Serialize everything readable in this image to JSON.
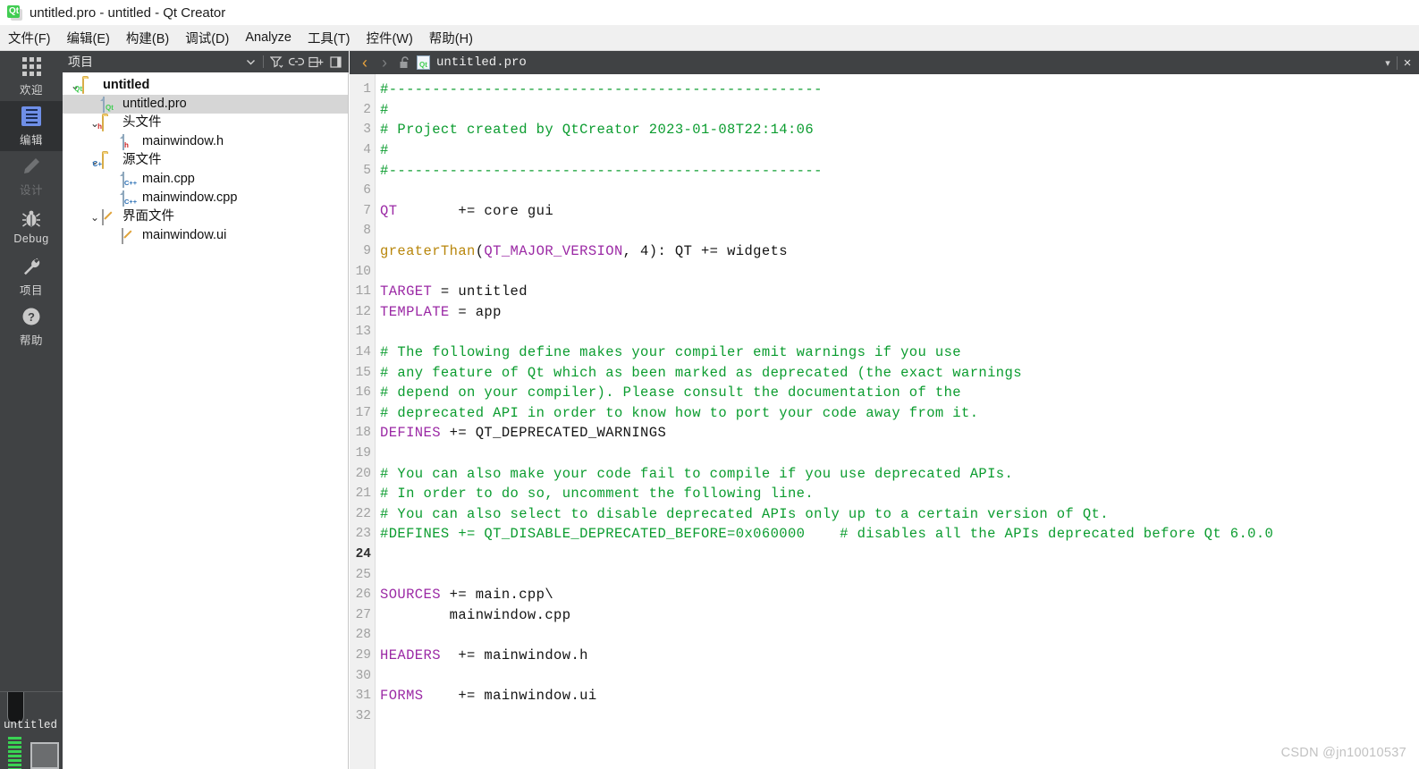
{
  "window": {
    "title": "untitled.pro - untitled - Qt Creator",
    "logo_text": "Qt"
  },
  "menubar": {
    "items": [
      {
        "label": "文件(F)",
        "name": "menu-file"
      },
      {
        "label": "编辑(E)",
        "name": "menu-edit"
      },
      {
        "label": "构建(B)",
        "name": "menu-build"
      },
      {
        "label": "调试(D)",
        "name": "menu-debug"
      },
      {
        "label": "Analyze",
        "name": "menu-analyze"
      },
      {
        "label": "工具(T)",
        "name": "menu-tools"
      },
      {
        "label": "控件(W)",
        "name": "menu-widgets"
      },
      {
        "label": "帮助(H)",
        "name": "menu-help"
      }
    ]
  },
  "modebar": {
    "items": [
      {
        "label": "欢迎",
        "icon": "grid-icon",
        "state": "normal"
      },
      {
        "label": "编辑",
        "icon": "document-icon",
        "state": "active"
      },
      {
        "label": "设计",
        "icon": "pencil-icon",
        "state": "disabled"
      },
      {
        "label": "Debug",
        "icon": "bug-icon",
        "state": "normal"
      },
      {
        "label": "项目",
        "icon": "wrench-icon",
        "state": "normal"
      },
      {
        "label": "帮助",
        "icon": "question-icon",
        "state": "normal"
      }
    ]
  },
  "kit_selector": {
    "name": "untitled"
  },
  "project_panel": {
    "title": "项目",
    "toolbar": [
      {
        "name": "chevron-down-icon"
      },
      {
        "name": "filter-icon"
      },
      {
        "name": "link-icon"
      },
      {
        "name": "split-pane-icon"
      },
      {
        "name": "close-panel-icon"
      }
    ],
    "tree": [
      {
        "label": "untitled",
        "indent": 0,
        "chev": "⌄",
        "icon": "folder-pro",
        "bold": true,
        "selected": false
      },
      {
        "label": "untitled.pro",
        "indent": 1,
        "chev": "",
        "icon": "file-pro",
        "bold": false,
        "selected": true
      },
      {
        "label": "头文件",
        "indent": 1,
        "chev": "⌄",
        "icon": "folder-h",
        "bold": false,
        "selected": false
      },
      {
        "label": "mainwindow.h",
        "indent": 2,
        "chev": "",
        "icon": "file-h",
        "bold": false,
        "selected": false
      },
      {
        "label": "源文件",
        "indent": 1,
        "chev": "⌄",
        "icon": "folder-cpp",
        "bold": false,
        "selected": false
      },
      {
        "label": "main.cpp",
        "indent": 2,
        "chev": "",
        "icon": "file-cpp",
        "bold": false,
        "selected": false
      },
      {
        "label": "mainwindow.cpp",
        "indent": 2,
        "chev": "",
        "icon": "file-cpp",
        "bold": false,
        "selected": false
      },
      {
        "label": "界面文件",
        "indent": 1,
        "chev": "⌄",
        "icon": "folder-ui",
        "bold": false,
        "selected": false
      },
      {
        "label": "mainwindow.ui",
        "indent": 2,
        "chev": "",
        "icon": "file-ui",
        "bold": false,
        "selected": false
      }
    ]
  },
  "editor": {
    "tab": {
      "back_arrow": "‹",
      "forward_arrow": "›",
      "lock_icon": "unlocked-icon",
      "filename": "untitled.pro",
      "dropdown": "▾",
      "close": "×"
    },
    "current_line": 24,
    "lines": [
      {
        "n": 1,
        "tokens": [
          {
            "t": "#--------------------------------------------------",
            "c": "comment"
          }
        ]
      },
      {
        "n": 2,
        "tokens": [
          {
            "t": "#",
            "c": "comment"
          }
        ]
      },
      {
        "n": 3,
        "tokens": [
          {
            "t": "# Project created by QtCreator 2023-01-08T22:14:06",
            "c": "comment"
          }
        ]
      },
      {
        "n": 4,
        "tokens": [
          {
            "t": "#",
            "c": "comment"
          }
        ]
      },
      {
        "n": 5,
        "tokens": [
          {
            "t": "#--------------------------------------------------",
            "c": "comment"
          }
        ]
      },
      {
        "n": 6,
        "tokens": []
      },
      {
        "n": 7,
        "tokens": [
          {
            "t": "QT",
            "c": "var"
          },
          {
            "t": "       += core gui",
            "c": "plain"
          }
        ]
      },
      {
        "n": 8,
        "tokens": []
      },
      {
        "n": 9,
        "tokens": [
          {
            "t": "greaterThan",
            "c": "func"
          },
          {
            "t": "(",
            "c": "plain"
          },
          {
            "t": "QT_MAJOR_VERSION",
            "c": "var"
          },
          {
            "t": ", 4): QT += widgets",
            "c": "plain"
          }
        ]
      },
      {
        "n": 10,
        "tokens": []
      },
      {
        "n": 11,
        "tokens": [
          {
            "t": "TARGET",
            "c": "var"
          },
          {
            "t": " = untitled",
            "c": "plain"
          }
        ]
      },
      {
        "n": 12,
        "tokens": [
          {
            "t": "TEMPLATE",
            "c": "var"
          },
          {
            "t": " = app",
            "c": "plain"
          }
        ]
      },
      {
        "n": 13,
        "tokens": []
      },
      {
        "n": 14,
        "tokens": [
          {
            "t": "# The following define makes your compiler emit warnings if you use",
            "c": "comment"
          }
        ]
      },
      {
        "n": 15,
        "tokens": [
          {
            "t": "# any feature of Qt which as been marked as deprecated (the exact warnings",
            "c": "comment"
          }
        ]
      },
      {
        "n": 16,
        "tokens": [
          {
            "t": "# depend on your compiler). Please consult the documentation of the",
            "c": "comment"
          }
        ]
      },
      {
        "n": 17,
        "tokens": [
          {
            "t": "# deprecated API in order to know how to port your code away from it.",
            "c": "comment"
          }
        ]
      },
      {
        "n": 18,
        "tokens": [
          {
            "t": "DEFINES",
            "c": "var"
          },
          {
            "t": " += QT_DEPRECATED_WARNINGS",
            "c": "plain"
          }
        ]
      },
      {
        "n": 19,
        "tokens": []
      },
      {
        "n": 20,
        "tokens": [
          {
            "t": "# You can also make your code fail to compile if you use deprecated APIs.",
            "c": "comment"
          }
        ]
      },
      {
        "n": 21,
        "tokens": [
          {
            "t": "# In order to do so, uncomment the following line.",
            "c": "comment"
          }
        ]
      },
      {
        "n": 22,
        "tokens": [
          {
            "t": "# You can also select to disable deprecated APIs only up to a certain version of Qt.",
            "c": "comment"
          }
        ]
      },
      {
        "n": 23,
        "tokens": [
          {
            "t": "#DEFINES += QT_DISABLE_DEPRECATED_BEFORE=0x060000    # disables all the APIs deprecated before Qt 6.0.0",
            "c": "comment"
          }
        ]
      },
      {
        "n": 24,
        "tokens": []
      },
      {
        "n": 25,
        "tokens": []
      },
      {
        "n": 26,
        "tokens": [
          {
            "t": "SOURCES",
            "c": "var"
          },
          {
            "t": " += main.cpp\\",
            "c": "plain"
          }
        ]
      },
      {
        "n": 27,
        "tokens": [
          {
            "t": "        mainwindow.cpp",
            "c": "plain"
          }
        ]
      },
      {
        "n": 28,
        "tokens": []
      },
      {
        "n": 29,
        "tokens": [
          {
            "t": "HEADERS",
            "c": "var"
          },
          {
            "t": "  += mainwindow.h",
            "c": "plain"
          }
        ]
      },
      {
        "n": 30,
        "tokens": []
      },
      {
        "n": 31,
        "tokens": [
          {
            "t": "FORMS",
            "c": "var"
          },
          {
            "t": "    += mainwindow.ui",
            "c": "plain"
          }
        ]
      },
      {
        "n": 32,
        "tokens": []
      }
    ]
  },
  "watermark": {
    "text": "CSDN @jn10010537"
  },
  "colors": {
    "comment": "#0b9c2f",
    "variable": "#9b29a5",
    "function": "#b8860b",
    "accent_blue": "#0b66c3",
    "qt_green": "#41cd52",
    "chrome_dark": "#404244",
    "selection_gray": "#d6d6d6"
  }
}
